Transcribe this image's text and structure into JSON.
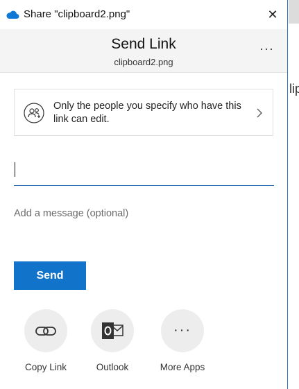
{
  "window": {
    "title": "Share \"clipboard2.png\"",
    "close_glyph": "✕"
  },
  "header": {
    "title": "Send Link",
    "subtitle": "clipboard2.png",
    "more_glyph": "···"
  },
  "permission": {
    "text": "Only the people you specify who have this link can edit."
  },
  "recipient": {
    "value": ""
  },
  "message": {
    "placeholder": "Add a message (optional)"
  },
  "send_button": {
    "label": "Send"
  },
  "share_options": [
    {
      "label": "Copy Link",
      "icon": "link-icon"
    },
    {
      "label": "Outlook",
      "icon": "outlook-icon"
    },
    {
      "label": "More Apps",
      "icon": "more-apps-icon"
    }
  ],
  "colors": {
    "accent": "#1273cb",
    "cloud": "#0f78d4"
  },
  "background_window": {
    "text": "lip"
  }
}
